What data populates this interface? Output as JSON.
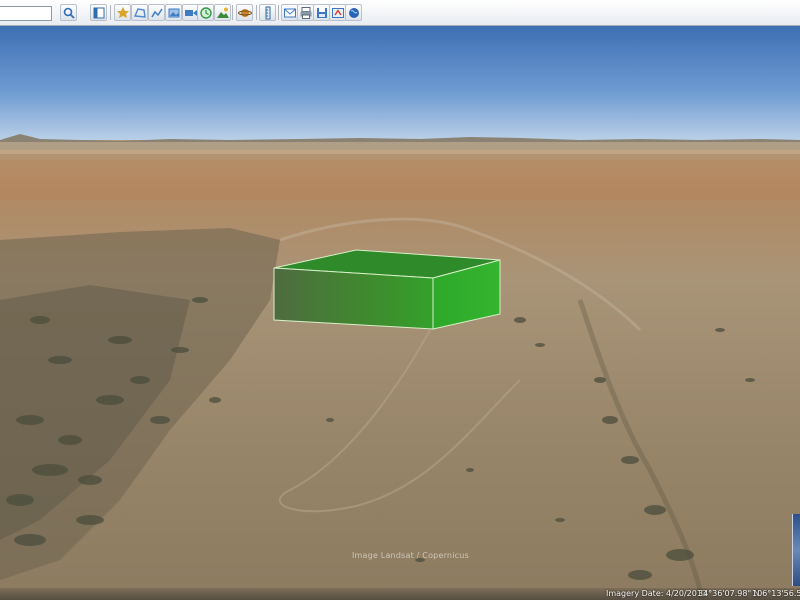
{
  "toolbar": {
    "search_value": "",
    "buttons": [
      {
        "name": "search-icon",
        "color": "#2f6cb4"
      },
      {
        "name": "sidebar-toggle-icon",
        "color": "#2f6cb4"
      },
      {
        "name": "add-placemark-icon",
        "color": "#d8a62a"
      },
      {
        "name": "add-polygon-icon",
        "color": "#4c8bd1"
      },
      {
        "name": "add-path-icon",
        "color": "#3f7cc4"
      },
      {
        "name": "add-image-overlay-icon",
        "color": "#3f7cc4"
      },
      {
        "name": "record-tour-icon",
        "color": "#3f7cc4"
      },
      {
        "name": "historical-imagery-icon",
        "color": "#2f9a48"
      },
      {
        "name": "sunlight-icon",
        "color": "#3a8a3a"
      },
      {
        "name": "switch-planet-icon",
        "color": "#c9872b"
      },
      {
        "name": "ruler-icon",
        "color": "#3568a8"
      },
      {
        "name": "email-icon",
        "color": "#3a78c2"
      },
      {
        "name": "print-icon",
        "color": "#5a6a7a"
      },
      {
        "name": "save-image-icon",
        "color": "#3a78c2"
      },
      {
        "name": "view-in-maps-icon",
        "color": "#3a78c2"
      },
      {
        "name": "globe-icon",
        "color": "#2a62b8"
      }
    ]
  },
  "scene": {
    "attribution": "Image Landsat / Copernicus",
    "box_color": "#2f8a2a",
    "sky_color": "#3f72b8"
  },
  "status": {
    "imagery_date": "Imagery Date: 4/20/2013",
    "latitude": "34°36'07.98\" N",
    "longitude": "106°13'56.51\""
  }
}
